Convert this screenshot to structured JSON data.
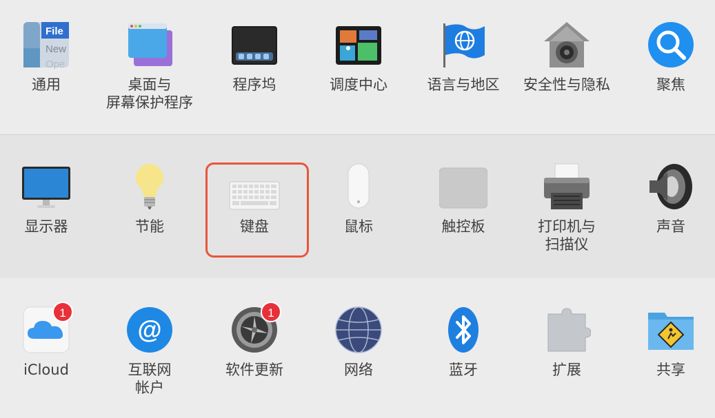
{
  "rows": [
    {
      "items": [
        {
          "label": "通用",
          "icon": "general-icon"
        },
        {
          "label": "桌面与\n屏幕保护程序",
          "icon": "desktop-screensaver-icon"
        },
        {
          "label": "程序坞",
          "icon": "dock-icon"
        },
        {
          "label": "调度中心",
          "icon": "mission-control-icon"
        },
        {
          "label": "语言与地区",
          "icon": "language-region-icon"
        },
        {
          "label": "安全性与隐私",
          "icon": "security-privacy-icon"
        },
        {
          "label": "聚焦",
          "icon": "spotlight-icon"
        }
      ]
    },
    {
      "items": [
        {
          "label": "显示器",
          "icon": "display-icon"
        },
        {
          "label": "节能",
          "icon": "energy-saver-icon"
        },
        {
          "label": "键盘",
          "icon": "keyboard-icon",
          "highlighted": true
        },
        {
          "label": "鼠标",
          "icon": "mouse-icon"
        },
        {
          "label": "触控板",
          "icon": "trackpad-icon"
        },
        {
          "label": "打印机与\n扫描仪",
          "icon": "printers-scanners-icon"
        },
        {
          "label": "声音",
          "icon": "sound-icon"
        }
      ]
    },
    {
      "items": [
        {
          "label": "iCloud",
          "icon": "icloud-icon",
          "badge": "1"
        },
        {
          "label": "互联网\n帐户",
          "icon": "internet-accounts-icon"
        },
        {
          "label": "软件更新",
          "icon": "software-update-icon",
          "badge": "1"
        },
        {
          "label": "网络",
          "icon": "network-icon"
        },
        {
          "label": "蓝牙",
          "icon": "bluetooth-icon"
        },
        {
          "label": "扩展",
          "icon": "extensions-icon"
        },
        {
          "label": "共享",
          "icon": "sharing-icon"
        }
      ]
    }
  ],
  "general_icon_text": [
    "File",
    "New",
    "Ope"
  ],
  "colors": {
    "highlight": "#e8553c",
    "badge": "#e8303a"
  }
}
